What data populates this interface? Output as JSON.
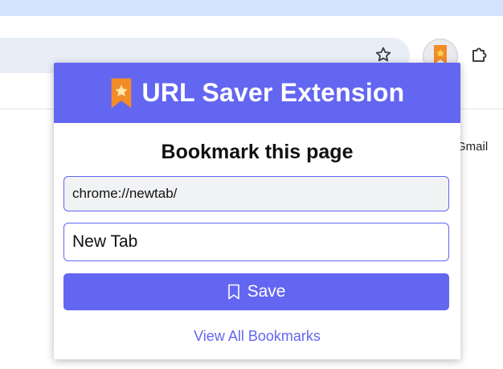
{
  "browser": {
    "bookmark_star_icon": "star-outline-icon",
    "extension_icon": "bookmark-ribbon-icon",
    "extensions_icon": "puzzle-icon",
    "background_link": "Gmail"
  },
  "popup": {
    "title": "URL Saver Extension",
    "header_icon": "bookmark-ribbon-icon",
    "subtitle": "Bookmark this page",
    "url_value": "chrome://newtab/",
    "title_value": "New Tab",
    "save_label": "Save",
    "save_icon": "bookmark-outline-icon",
    "view_all_label": "View All Bookmarks"
  },
  "colors": {
    "accent": "#6366f1",
    "toolbar_band": "#d3e3fd",
    "omnibox": "#e9eef6",
    "ribbon_orange": "#f28c28",
    "ribbon_star": "#ffd54f"
  }
}
